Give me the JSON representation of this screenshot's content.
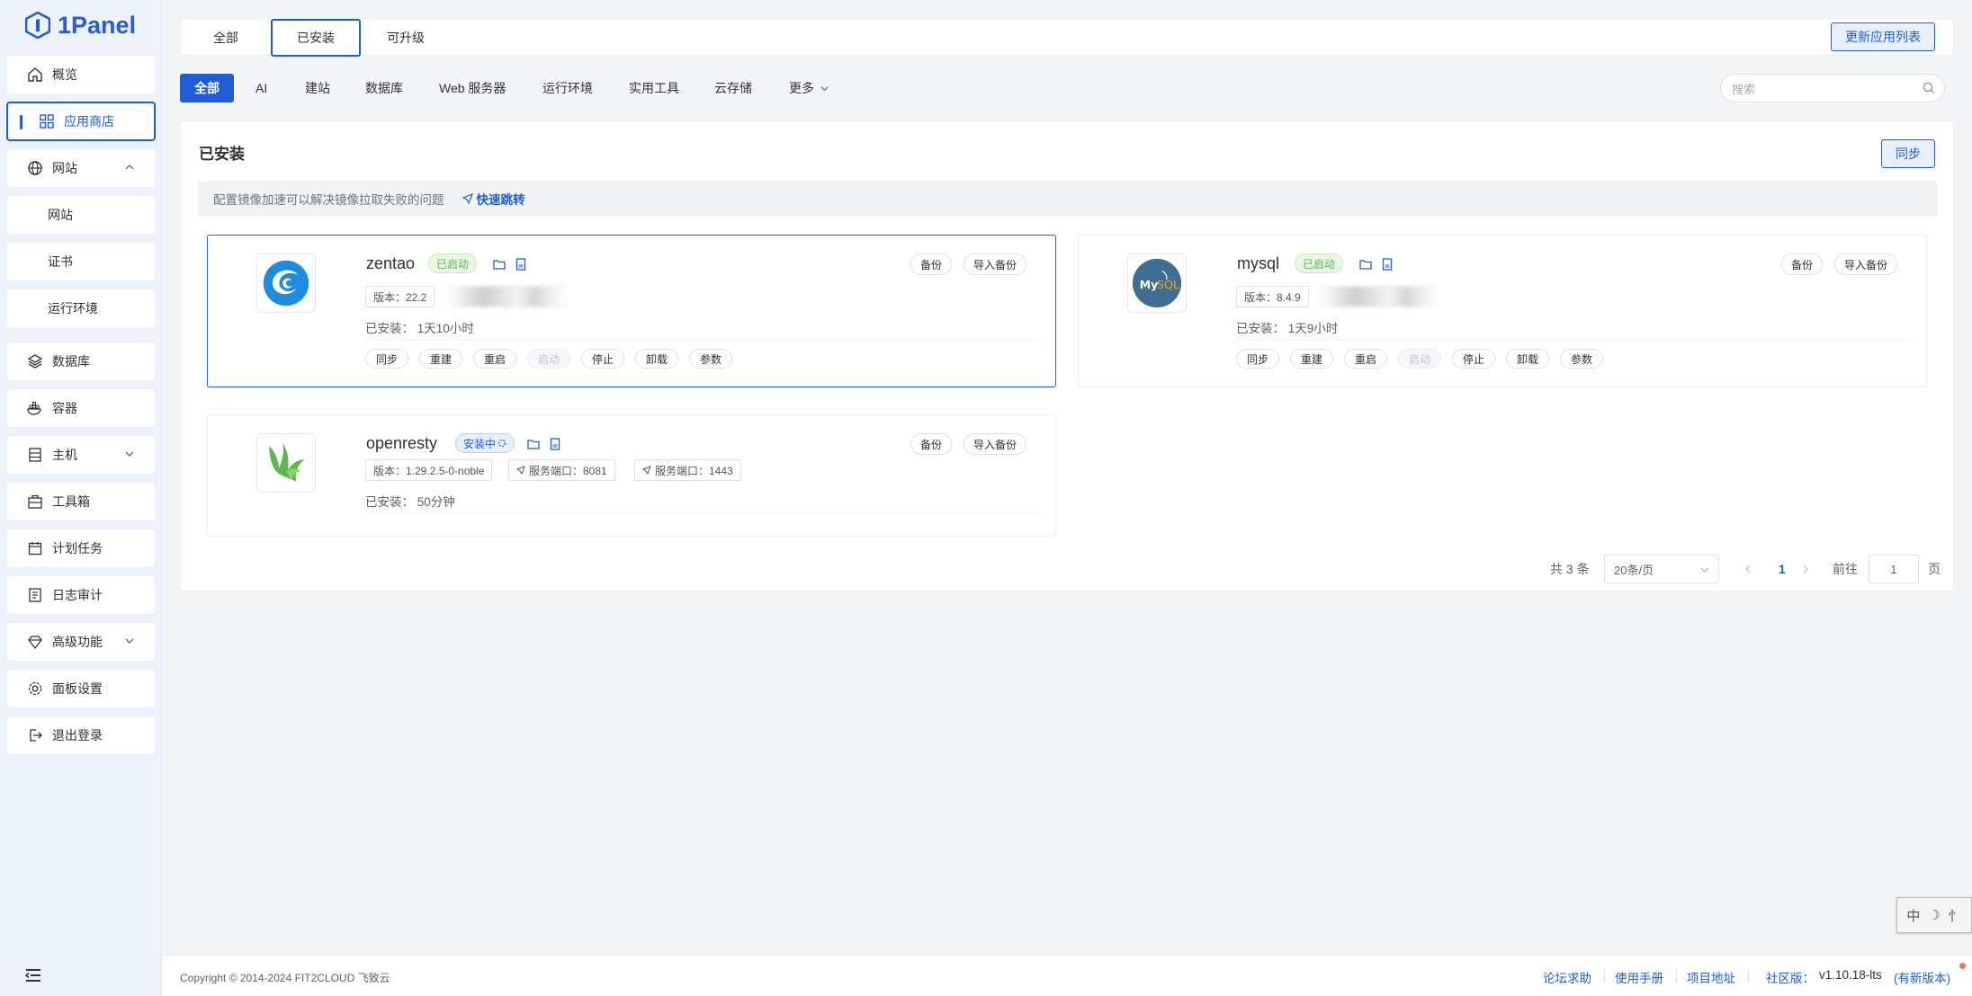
{
  "app": {
    "name": "1Panel",
    "accent": "#1f5cd6"
  },
  "sidebar": {
    "items": [
      {
        "label": "概览",
        "icon": "home-icon"
      },
      {
        "label": "应用商店",
        "icon": "grid-icon",
        "active": true
      },
      {
        "label": "网站",
        "icon": "globe-icon",
        "expanded": true
      },
      {
        "label": "网站",
        "sub": true
      },
      {
        "label": "证书",
        "sub": true
      },
      {
        "label": "运行环境",
        "sub": true
      },
      {
        "label": "数据库",
        "icon": "database-icon"
      },
      {
        "label": "容器",
        "icon": "docker-icon"
      },
      {
        "label": "主机",
        "icon": "server-icon"
      },
      {
        "label": "工具箱",
        "icon": "toolbox-icon"
      },
      {
        "label": "计划任务",
        "icon": "calendar-icon"
      },
      {
        "label": "日志审计",
        "icon": "log-icon"
      },
      {
        "label": "高级功能",
        "icon": "diamond-icon"
      },
      {
        "label": "面板设置",
        "icon": "gear-icon"
      },
      {
        "label": "退出登录",
        "icon": "logout-icon"
      }
    ]
  },
  "topTabs": {
    "all": "全部",
    "installed": "已安装",
    "upgradable": "可升级",
    "update_list": "更新应用列表"
  },
  "categories": [
    "全部",
    "AI",
    "建站",
    "数据库",
    "Web 服务器",
    "运行环境",
    "实用工具",
    "云存储",
    "更多"
  ],
  "search": {
    "placeholder": "搜索"
  },
  "panel": {
    "title": "已安装",
    "sync": "同步",
    "notice": "配置镜像加速可以解决镜像拉取失败的问题",
    "quick_jump": "快速跳转"
  },
  "apps": [
    {
      "name": "zentao",
      "status": "已启动",
      "version": "版本：22.2",
      "installed": "已安装：   1天10小时",
      "backup": "备份",
      "import_backup": "导入备份",
      "actions": [
        "同步",
        "重建",
        "重启",
        "启动",
        "停止",
        "卸载",
        "参数"
      ]
    },
    {
      "name": "mysql",
      "status": "已启动",
      "version": "版本：8.4.9",
      "installed": "已安装：   1天9小时",
      "backup": "备份",
      "import_backup": "导入备份",
      "actions": [
        "同步",
        "重建",
        "重启",
        "启动",
        "停止",
        "卸载",
        "参数"
      ]
    },
    {
      "name": "openresty",
      "status": "安装中",
      "version": "版本：1.29.2.5-0-noble",
      "port_http": "服务端口：8081",
      "port_https": "服务端口：1443",
      "installed": "已安装：   50分钟",
      "backup": "备份",
      "import_backup": "导入备份"
    }
  ],
  "pagination": {
    "total": "共 3 条",
    "page_size": "20条/页",
    "current": "1",
    "goto_label": "前往",
    "goto_value": "1",
    "page_unit": "页"
  },
  "footer": {
    "copyright": "Copyright © 2014-2024 FIT2CLOUD 飞致云",
    "forum": "论坛求助",
    "manual": "使用手册",
    "project": "项目地址",
    "edition": "社区版：",
    "version": "v1.10.18-lts",
    "new_version": "(有新版本)"
  },
  "ime": {
    "chars": [
      "中",
      "☽",
      "⺖"
    ]
  }
}
